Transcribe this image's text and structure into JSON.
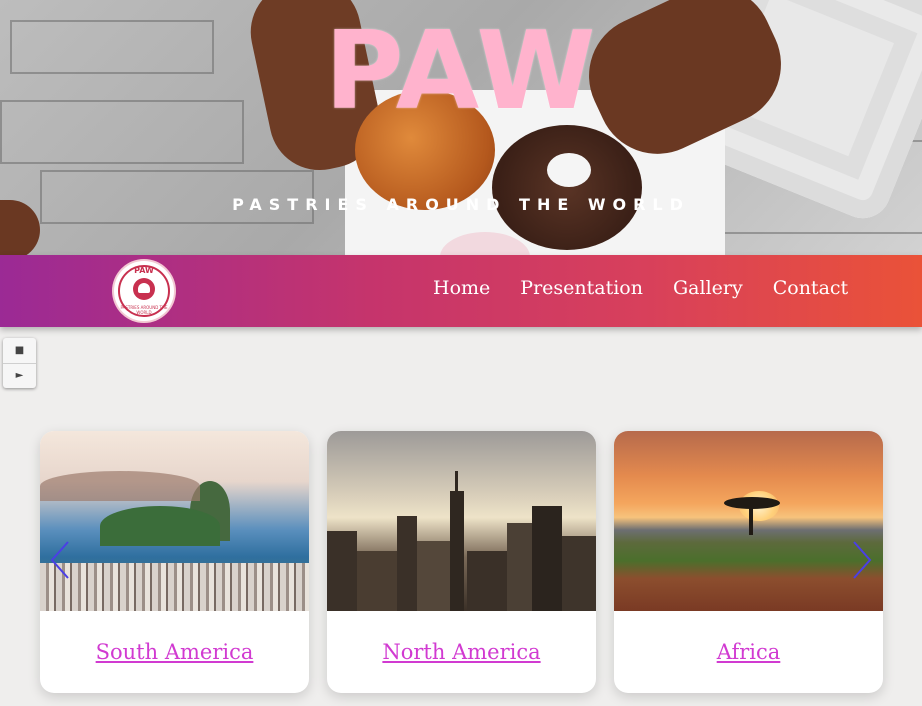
{
  "hero": {
    "title": "PAW",
    "subtitle": "PASTRIES AROUND THE WORLD"
  },
  "navbar": {
    "logo": {
      "brand": "PAW",
      "tagline": "PASTRIES AROUND THE WORLD"
    },
    "links": [
      {
        "label": "Home"
      },
      {
        "label": "Presentation"
      },
      {
        "label": "Gallery"
      },
      {
        "label": "Contact"
      }
    ]
  },
  "slider": {
    "controls": {
      "stop_icon": "stop-icon",
      "play_icon": "play-icon",
      "stop_glyph": "■",
      "play_glyph": "►"
    },
    "arrows": {
      "prev_icon": "chevron-left-icon",
      "next_icon": "chevron-right-icon",
      "color": "#4b3fe6"
    },
    "cards": [
      {
        "label": "South America"
      },
      {
        "label": "North America"
      },
      {
        "label": "Africa"
      }
    ]
  },
  "colors": {
    "title_pink": "#ffb3cd",
    "link_magenta": "#d13ad1",
    "nav_gradient_start": "#9b2a95",
    "nav_gradient_end": "#ea5238"
  }
}
